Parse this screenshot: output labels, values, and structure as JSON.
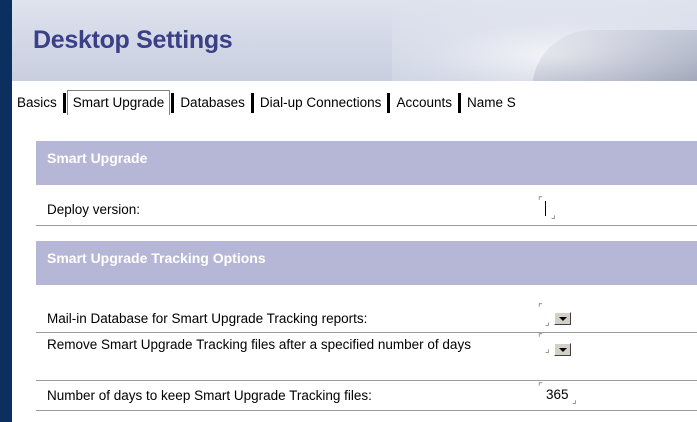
{
  "window": {
    "title": "Desktop Settings"
  },
  "tabs": [
    {
      "label": "Basics",
      "active": false
    },
    {
      "label": "Smart Upgrade",
      "active": true
    },
    {
      "label": "Databases",
      "active": false
    },
    {
      "label": "Dial-up Connections",
      "active": false
    },
    {
      "label": "Accounts",
      "active": false
    },
    {
      "label": "Name S",
      "active": false
    }
  ],
  "sections": {
    "smart_upgrade": {
      "title": "Smart Upgrade",
      "deploy_label": "Deploy version:",
      "deploy_value": ""
    },
    "tracking": {
      "title": "Smart Upgrade Tracking Options",
      "mailin_label": "Mail-in Database for Smart Upgrade Tracking reports:",
      "mailin_value": "",
      "remove_label": "Remove Smart Upgrade Tracking files after a specified number of days",
      "remove_value": "",
      "days_label": "Number of days to keep Smart Upgrade Tracking files:",
      "days_value": "365"
    }
  },
  "colors": {
    "background": "#0b2f5e",
    "title": "#3a3f86",
    "section_header": "#b6b6d6"
  },
  "icons": {
    "field_open": "field-open-bracket-icon",
    "field_close": "field-close-bracket-icon",
    "dropdown": "dropdown-arrow-icon"
  }
}
